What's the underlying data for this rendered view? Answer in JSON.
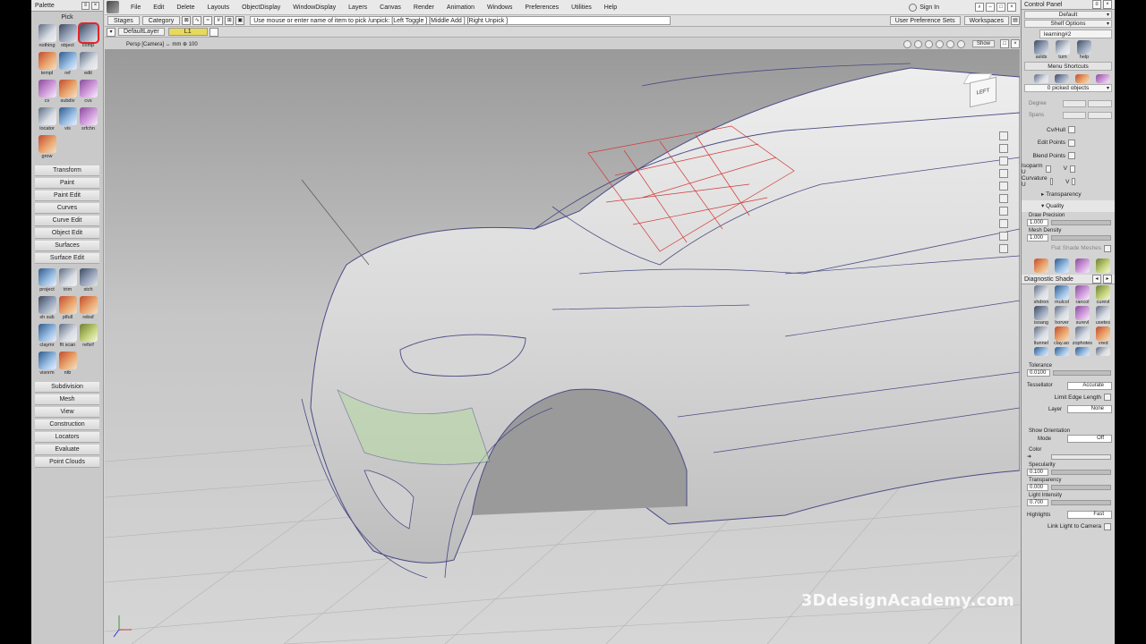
{
  "palette": {
    "title": "Palette",
    "pick_label": "Pick",
    "pick_tools": [
      "nothing",
      "object",
      "comp",
      "templ",
      "ref",
      "edit",
      "cv",
      "subdiv",
      "cvs",
      "locator",
      "vis",
      "srfchn",
      "grow"
    ],
    "sections_top": [
      "Transform",
      "Paint",
      "Paint Edit",
      "Curves",
      "Curve Edit",
      "Object Edit",
      "Surfaces",
      "Surface Edit"
    ],
    "surface_tools": [
      "project",
      "trim",
      "stch",
      "sh sub",
      "plfull",
      "rebsf",
      "claymr",
      "flt scan",
      "refsrf",
      "visnrm",
      "ntb"
    ],
    "sections_bottom": [
      "Subdivision",
      "Mesh",
      "View",
      "Construction",
      "Locators",
      "Evaluate",
      "Point Clouds"
    ]
  },
  "menubar": {
    "items": [
      "File",
      "Edit",
      "Delete",
      "Layouts",
      "ObjectDisplay",
      "WindowDisplay",
      "Layers",
      "Canvas",
      "Render",
      "Animation",
      "Windows",
      "Preferences",
      "Utilities",
      "Help"
    ],
    "sign_in": "Sign In"
  },
  "toolbar": {
    "stages": "Stages",
    "category": "Category",
    "prompt": "Use mouse or enter name of item to pick /unpick: [Left Toggle ] [Middle Add ] [Right Unpick ]",
    "user_pref": "User Preference Sets",
    "workspaces": "Workspaces"
  },
  "layers": {
    "default_layer": "DefaultLayer",
    "active": "L1"
  },
  "viewport": {
    "camera_info": "Persp [Camera] ↔ mm ⊕ 100",
    "show_label": "Show",
    "cube_label": "LEFT",
    "watermark": "3DdesignAcademy.com"
  },
  "control_panel": {
    "title": "Control Panel",
    "default": "Default",
    "shelf_options": "Shelf Options",
    "shelf_tab": "learning#2",
    "shelf_items": [
      "aslds",
      "turn",
      "help"
    ],
    "menu_shortcuts": "Menu Shortcuts",
    "picked": "0 picked objects",
    "degree": "Degree",
    "spans": "Spans",
    "checks": [
      "Cv/Hull",
      "Edit Points",
      "Blend Points",
      "Isoparm U",
      "Curvature U"
    ],
    "check_v": "V",
    "transparency": "Transparency",
    "quality": "Quality",
    "draw_precision_label": "Draw Precision",
    "draw_precision": "1.000",
    "mesh_density_label": "Mesh Density",
    "mesh_density": "1.000",
    "flat_shade": "Flat Shade Meshes",
    "diag_title": "Diagnostic Shade",
    "diag_items": [
      "shdron",
      "mulcol",
      "rancol",
      "curevl",
      "isoang",
      "horver",
      "surevl",
      "usetes",
      "ltunnel",
      "clay.ao",
      "zophotes",
      "vred"
    ],
    "tolerance_label": "Tolerance",
    "tolerance": "0.0100",
    "tessellator_label": "Tessellator",
    "tessellator": "Accurate",
    "limit_edge": "Limit Edge Length",
    "layer_label": "Layer",
    "layer_value": "None",
    "show_orientation": "Show Orientation",
    "mode_label": "Mode",
    "mode_value": "Off",
    "color_label": "Color",
    "specularity_label": "Specularity",
    "specularity": "0.100",
    "transparency_label": "Transparency",
    "transparency_val": "0.000",
    "light_intensity_label": "Light Intensity",
    "light_intensity": "0.700",
    "highlights_label": "Highlights",
    "highlights": "Fast",
    "link_light": "Link Light to Camera"
  }
}
